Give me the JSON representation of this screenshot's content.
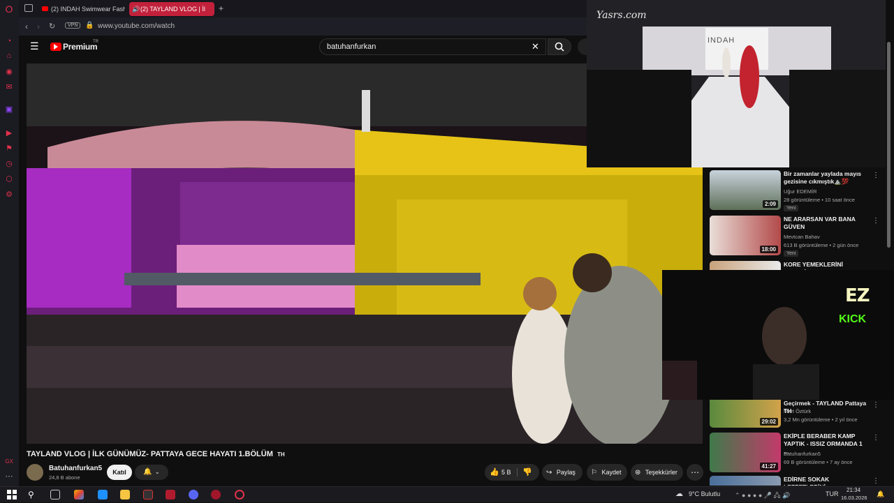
{
  "browser": {
    "tabs": [
      {
        "label": "(2) INDAH Swimwear Fash"
      },
      {
        "label": "(2) TAYLAND VLOG | İl"
      }
    ],
    "vpn_label": "VPN",
    "url": "www.youtube.com/watch"
  },
  "youtube": {
    "logo_label": "Premium",
    "logo_sup": "TR",
    "search_value": "batuhanfurkan"
  },
  "video": {
    "title": "TAYLAND VLOG | İLK GÜNÜMÜZ- PATTAYA GECE HAYATI 1.BÖLÜM",
    "title_flag": "TH",
    "channel_name": "Batuhanfurkan5",
    "subscribers": "24,8 B abone",
    "join_label": "Katıl",
    "like_count": "5 B",
    "share_label": "Paylaş",
    "save_label": "Kaydet",
    "thanks_label": "Teşekkürler"
  },
  "overlays": {
    "runway_watermark": "Yasrs.com",
    "runway_brand": "INDAH",
    "cam_logo_top": "EZ",
    "cam_logo_bottom": "KICK"
  },
  "suggestions": [
    {
      "title": "Bir zamanlar  yaylada mayıs gezisine cıkmıştık⛰️💯",
      "channel": "Uğur EDEMİR",
      "stats": "28 görüntüleme • 10 saat önce",
      "badge": "Yeni",
      "duration": "2:09"
    },
    {
      "title": "NE ARARSAN VAR BANA GÜVEN",
      "channel": "Mevtcan Bahav",
      "stats": "613 B görüntüleme • 2 gün önce",
      "badge": "Yeni",
      "duration": "18:00"
    },
    {
      "title": "KORE YEMEKLERİNİ DENEDİK",
      "channel": "",
      "stats": "",
      "badge": "",
      "duration": ""
    },
    {
      "title": "Geçirmek - TAYLAND Pattaya TH",
      "channel": "Mert Öztürk",
      "stats": "3,2 Mn görüntüleme • 2 yıl önce",
      "badge": "",
      "duration": "29:02"
    },
    {
      "title": "EKİPLE BERABER KAMP YAPTIK - ISSIZ ORMANDA 1 ...",
      "channel": "Batuhanfurkan5",
      "stats": "69 B görüntüleme • 7 ay önce",
      "badge": "",
      "duration": "41:27"
    },
    {
      "title": "EDİRNE SOKAK LEZZETLERİNİ",
      "channel": "",
      "stats": "",
      "badge": "",
      "duration": ""
    }
  ],
  "taskbar": {
    "weather": "9°C  Bulutlu",
    "language": "TUR",
    "time": "21:34",
    "date": "16.03.2026"
  }
}
